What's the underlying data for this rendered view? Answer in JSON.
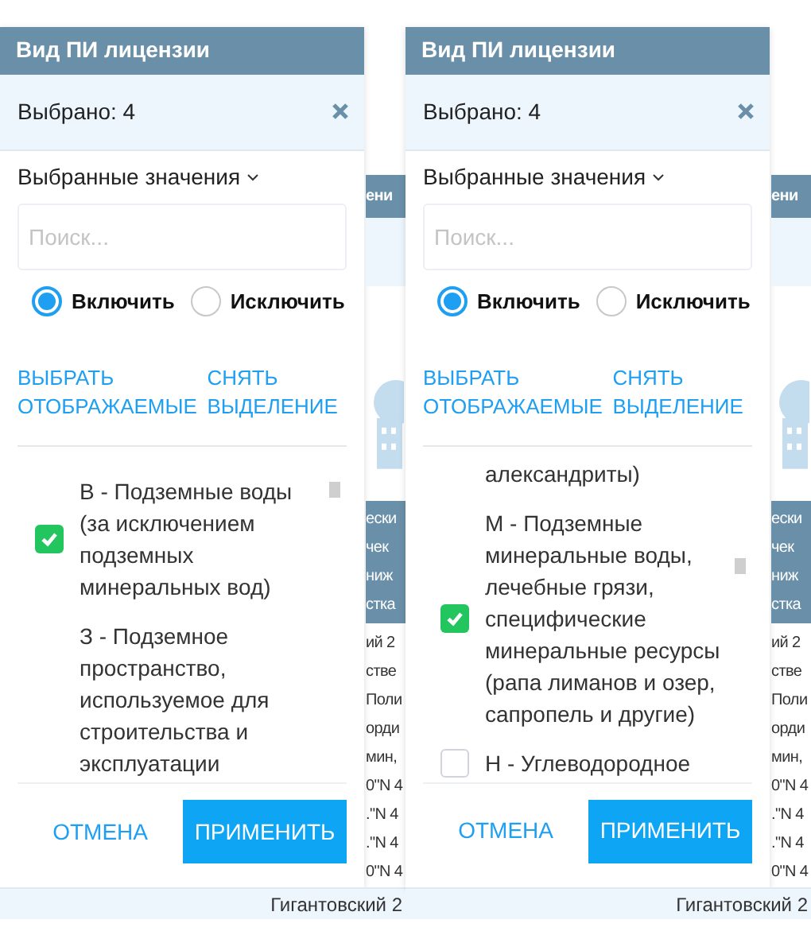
{
  "views": [
    {
      "popup": {
        "title": "Вид ПИ лицензии",
        "selected_count": "Выбрано: 4",
        "section_label": "Выбранные значения",
        "search": {
          "placeholder": "Поиск..."
        },
        "modes": [
          {
            "label": "Включить",
            "selected": true
          },
          {
            "label": "Исключить",
            "selected": false
          }
        ],
        "actions": [
          "ВЫБРАТЬ ОТОБРАЖАЕМЫЕ",
          "СНЯТЬ ВЫДЕЛЕНИЕ"
        ],
        "options": [
          {
            "kind": "option",
            "label": "В - Подземные воды (за исключением подземных минеральных вод)",
            "checked": true
          },
          {
            "kind": "fragment",
            "label": "З - Подземное пространство, используемое для строительства и эксплуатации"
          }
        ],
        "cancel": "ОТМЕНА",
        "apply": "ПРИМЕНИТЬ"
      },
      "table_behind": {
        "header": "ени",
        "group": [
          "ески",
          "чек",
          "ниж",
          "стка"
        ],
        "cells": [
          "ий 2",
          "стве",
          "Поли",
          "орди",
          "мин,",
          "0\"N 4",
          ".\"N 4",
          ".\"N 4",
          "0\"N 4"
        ],
        "footer": "Гигантовский 2"
      }
    },
    {
      "popup": {
        "title": "Вид ПИ лицензии",
        "selected_count": "Выбрано: 4",
        "section_label": "Выбранные значения",
        "search": {
          "placeholder": "Поиск..."
        },
        "modes": [
          {
            "label": "Включить",
            "selected": true
          },
          {
            "label": "Исключить",
            "selected": false
          }
        ],
        "actions": [
          "ВЫБРАТЬ ОТОБРАЖАЕМЫЕ",
          "СНЯТЬ ВЫДЕЛЕНИЕ"
        ],
        "options": [
          {
            "kind": "fragment",
            "label": "александриты)"
          },
          {
            "kind": "option",
            "label": "М - Подземные минеральные воды, лечебные грязи, специфические минеральные ресурсы (рапа лиманов и озер, сапропель и другие)",
            "checked": true
          },
          {
            "kind": "option",
            "label": "Н - Углеводородное",
            "checked": false
          }
        ],
        "cancel": "ОТМЕНА",
        "apply": "ПРИМЕНИТЬ"
      },
      "table_behind": {
        "header": "ени",
        "group": [
          "ески",
          "чек",
          "ниж",
          "стка"
        ],
        "cells": [
          "ий 2",
          "стве",
          "Поли",
          "орди",
          "мин,",
          "0\"N 4",
          ".\"N 4",
          ".\"N 4",
          "0\"N 4"
        ],
        "footer": "Гигантовский 2"
      }
    }
  ]
}
